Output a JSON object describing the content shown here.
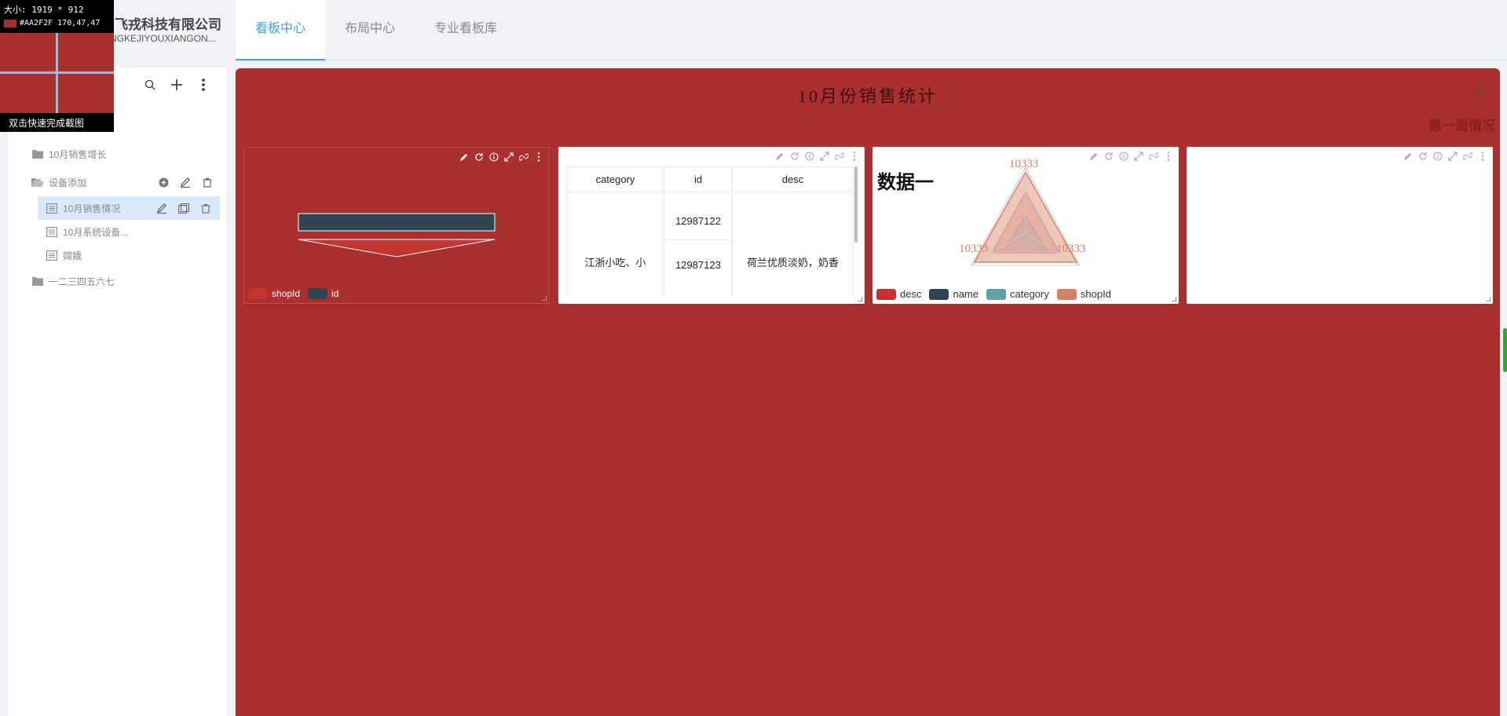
{
  "header": {
    "company_name": "飞戎科技有限公司",
    "company_pinyin": "NGKEJIYOUXIANGON...",
    "tabs": [
      {
        "label": "看板中心",
        "active": true
      },
      {
        "label": "布局中心",
        "active": false
      },
      {
        "label": "专业看板库",
        "active": false
      }
    ]
  },
  "capture_overlay": {
    "size_text": "大小: 1919 * 912",
    "color_text": "#AA2F2F 170,47,47",
    "hint": "双击快速完成截图"
  },
  "sidebar": {
    "tree": [
      {
        "label": "10月销售增长",
        "type": "folder"
      },
      {
        "label": "设备添加",
        "type": "folder-open"
      },
      {
        "label": "10月销售情况",
        "type": "board"
      },
      {
        "label": "10月系统设备...",
        "type": "board"
      },
      {
        "label": "嫦娥",
        "type": "board"
      },
      {
        "label": "一二三四五六七",
        "type": "folder"
      }
    ]
  },
  "board": {
    "title": "10月份销售统计",
    "subtitle": "第一周情况",
    "background": "#AA2F2F",
    "card1": {
      "legend": [
        {
          "label": "shopId",
          "color": "#c23531"
        },
        {
          "label": "id",
          "color": "#2f4554"
        }
      ]
    },
    "card2": {
      "columns": [
        "category",
        "id",
        "desc"
      ],
      "category_cell": "江浙小吃、小",
      "ids": [
        "12987122",
        "12987123"
      ],
      "desc_cell": "荷兰优质淡奶，奶香"
    },
    "card3": {
      "title": "数据一",
      "labels": [
        "10333",
        "10333",
        "10333"
      ],
      "legend": [
        {
          "label": "desc",
          "color": "#c23531"
        },
        {
          "label": "name",
          "color": "#2f4554"
        },
        {
          "label": "category",
          "color": "#61a0a8"
        },
        {
          "label": "shopId",
          "color": "#d48265"
        }
      ]
    }
  }
}
